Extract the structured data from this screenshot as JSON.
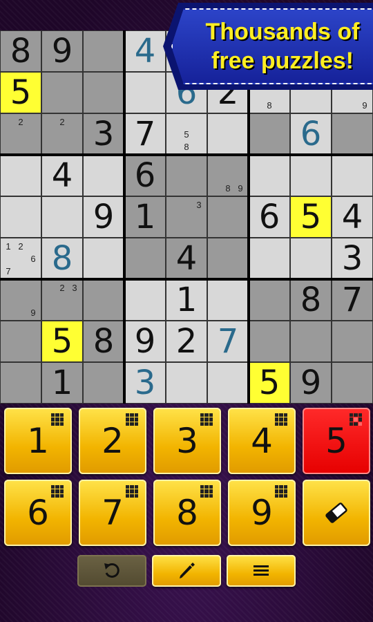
{
  "banner": {
    "line1": "Thousands of",
    "line2": "free puzzles!"
  },
  "colors": {
    "highlight": "#ffff33",
    "user_digit": "#2a6a8c",
    "active_key": "#e60000",
    "key": "#f2b400"
  },
  "board": {
    "rows": [
      [
        {
          "v": "8",
          "t": "given",
          "s": "dark"
        },
        {
          "v": "9",
          "t": "given",
          "s": "dark"
        },
        {
          "v": "",
          "s": "dark"
        },
        {
          "v": "4",
          "t": "user",
          "s": "light"
        },
        {
          "v": "",
          "s": "light"
        },
        {
          "v": "",
          "s": "light"
        },
        {
          "v": "",
          "s": "light"
        },
        {
          "v": "",
          "s": "light"
        },
        {
          "v": "",
          "s": "light"
        }
      ],
      [
        {
          "v": "5",
          "t": "given",
          "s": "hl"
        },
        {
          "v": "",
          "s": "dark"
        },
        {
          "v": "",
          "s": "dark"
        },
        {
          "v": "",
          "s": "light"
        },
        {
          "v": "6",
          "t": "user",
          "s": "light"
        },
        {
          "v": "2",
          "t": "given",
          "s": "light"
        },
        {
          "v": "",
          "s": "light",
          "n": [
            "",
            "",
            "",
            "",
            "",
            "",
            "",
            "8",
            ""
          ]
        },
        {
          "v": "",
          "s": "light"
        },
        {
          "v": "",
          "s": "light",
          "n": [
            "",
            "",
            "",
            "",
            "",
            "",
            "",
            "",
            "9"
          ]
        }
      ],
      [
        {
          "v": "",
          "s": "dark",
          "n": [
            "",
            "2",
            "",
            "",
            "",
            "",
            "",
            "",
            ""
          ]
        },
        {
          "v": "",
          "s": "dark",
          "n": [
            "",
            "2",
            "",
            "",
            "",
            "",
            "",
            "",
            ""
          ]
        },
        {
          "v": "3",
          "t": "given",
          "s": "dark"
        },
        {
          "v": "7",
          "t": "given",
          "s": "light"
        },
        {
          "v": "",
          "s": "light",
          "n": [
            "",
            "",
            "",
            "",
            "5",
            "",
            "",
            "8",
            ""
          ]
        },
        {
          "v": "",
          "s": "light"
        },
        {
          "v": "",
          "s": "dark"
        },
        {
          "v": "6",
          "t": "user",
          "s": "light"
        },
        {
          "v": "",
          "s": "dark"
        }
      ],
      [
        {
          "v": "",
          "s": "light"
        },
        {
          "v": "4",
          "t": "given",
          "s": "light"
        },
        {
          "v": "",
          "s": "light"
        },
        {
          "v": "6",
          "t": "given",
          "s": "dark"
        },
        {
          "v": "",
          "s": "dark"
        },
        {
          "v": "",
          "s": "dark",
          "n": [
            "",
            "",
            "",
            "",
            "",
            "",
            "",
            "8",
            "9"
          ]
        },
        {
          "v": "",
          "s": "light"
        },
        {
          "v": "",
          "s": "light"
        },
        {
          "v": "",
          "s": "light"
        }
      ],
      [
        {
          "v": "",
          "s": "light"
        },
        {
          "v": "",
          "s": "light"
        },
        {
          "v": "9",
          "t": "given",
          "s": "light"
        },
        {
          "v": "1",
          "t": "given",
          "s": "dark"
        },
        {
          "v": "",
          "s": "dark",
          "n": [
            "",
            "",
            "3",
            "",
            "",
            "",
            "",
            "",
            ""
          ]
        },
        {
          "v": "",
          "s": "dark"
        },
        {
          "v": "6",
          "t": "given",
          "s": "light"
        },
        {
          "v": "5",
          "t": "given",
          "s": "hl"
        },
        {
          "v": "4",
          "t": "given",
          "s": "light"
        }
      ],
      [
        {
          "v": "",
          "s": "light",
          "n": [
            "1",
            "2",
            "",
            "",
            "",
            "6",
            "7",
            "",
            ""
          ]
        },
        {
          "v": "8",
          "t": "user",
          "s": "light"
        },
        {
          "v": "",
          "s": "light"
        },
        {
          "v": "",
          "s": "dark"
        },
        {
          "v": "4",
          "t": "given",
          "s": "dark"
        },
        {
          "v": "",
          "s": "dark"
        },
        {
          "v": "",
          "s": "light"
        },
        {
          "v": "",
          "s": "light"
        },
        {
          "v": "3",
          "t": "given",
          "s": "light"
        }
      ],
      [
        {
          "v": "",
          "s": "dark",
          "n": [
            "",
            "",
            "",
            "",
            "",
            "",
            "",
            "",
            "9"
          ]
        },
        {
          "v": "",
          "s": "dark",
          "n": [
            "",
            "2",
            "3",
            "",
            "",
            "",
            "",
            "",
            ""
          ]
        },
        {
          "v": "",
          "s": "dark"
        },
        {
          "v": "",
          "s": "light"
        },
        {
          "v": "1",
          "t": "given",
          "s": "light"
        },
        {
          "v": "",
          "s": "light"
        },
        {
          "v": "",
          "s": "dark"
        },
        {
          "v": "8",
          "t": "given",
          "s": "dark"
        },
        {
          "v": "7",
          "t": "given",
          "s": "dark"
        }
      ],
      [
        {
          "v": "",
          "s": "dark"
        },
        {
          "v": "5",
          "t": "given",
          "s": "hl"
        },
        {
          "v": "8",
          "t": "given",
          "s": "dark"
        },
        {
          "v": "9",
          "t": "given",
          "s": "light"
        },
        {
          "v": "2",
          "t": "given",
          "s": "light"
        },
        {
          "v": "7",
          "t": "user",
          "s": "light"
        },
        {
          "v": "",
          "s": "dark"
        },
        {
          "v": "",
          "s": "dark"
        },
        {
          "v": "",
          "s": "dark"
        }
      ],
      [
        {
          "v": "",
          "s": "dark"
        },
        {
          "v": "1",
          "t": "given",
          "s": "dark"
        },
        {
          "v": "",
          "s": "dark"
        },
        {
          "v": "3",
          "t": "user",
          "s": "light"
        },
        {
          "v": "",
          "s": "light"
        },
        {
          "v": "",
          "s": "light"
        },
        {
          "v": "5",
          "t": "given",
          "s": "hl"
        },
        {
          "v": "9",
          "t": "given",
          "s": "dark"
        },
        {
          "v": "",
          "s": "dark"
        }
      ]
    ]
  },
  "keypad": {
    "keys": [
      "1",
      "2",
      "3",
      "4",
      "5",
      "6",
      "7",
      "8",
      "9"
    ],
    "active": "5",
    "eraser_icon": "eraser-icon"
  },
  "toolbar": {
    "undo_icon": "undo-icon",
    "pencil_icon": "pencil-icon",
    "menu_icon": "menu-icon"
  }
}
